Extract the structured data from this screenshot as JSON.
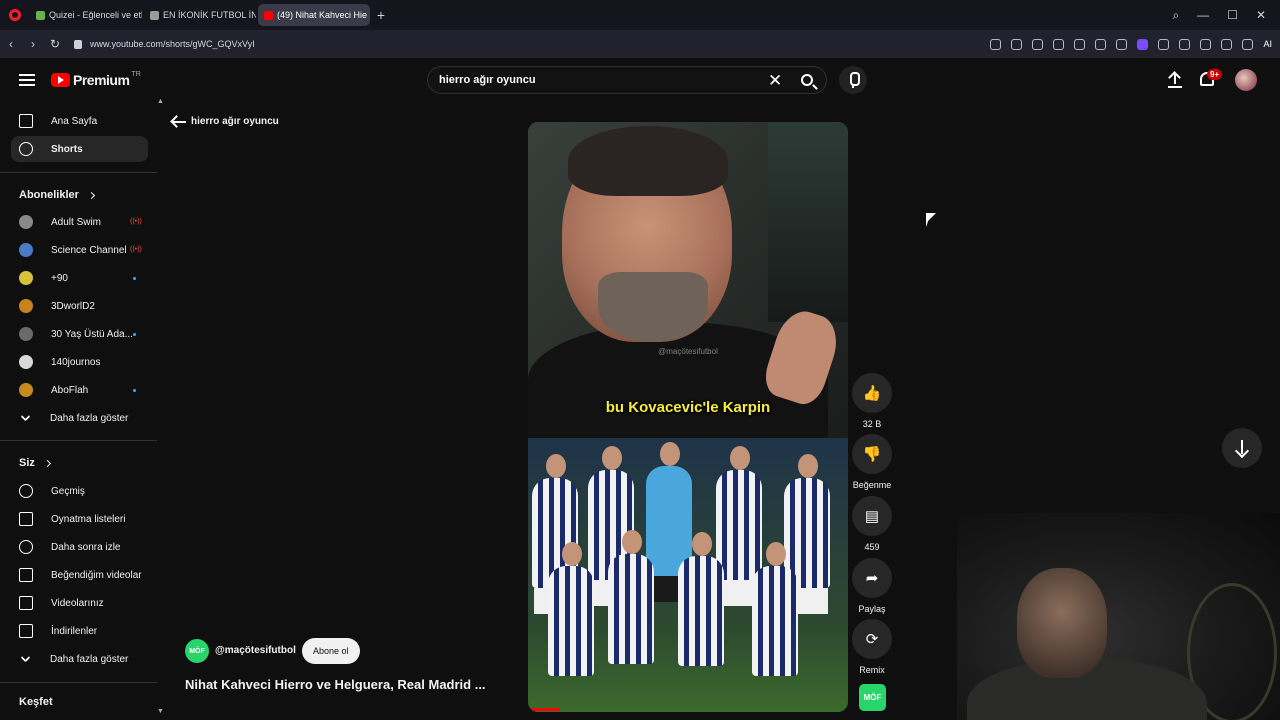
{
  "browser": {
    "tabs": [
      {
        "label": "Quizei - Eğlenceli ve etkile",
        "fav": "#6ab04c",
        "active": false
      },
      {
        "label": "EN İKONİK FUTBOL İNTİKA",
        "fav": "#9b9b9b",
        "active": false
      },
      {
        "label": "(49) Nihat Kahveci Hie",
        "fav": "#ff0000",
        "active": true
      }
    ],
    "new_tab": "+",
    "url": "www.youtube.com/shorts/gWC_GQVxVyI",
    "ai_label": "AI"
  },
  "header": {
    "logo_text": "Premium",
    "logo_sup": "TR",
    "search_value": "hierro ağır oyuncu",
    "notification_count": "9+"
  },
  "sidebar": {
    "main": [
      {
        "label": "Ana Sayfa",
        "icon": "home-icon"
      },
      {
        "label": "Shorts",
        "icon": "shorts-icon",
        "active": true
      }
    ],
    "subscriptions_title": "Abonelikler",
    "subscriptions": [
      {
        "label": "Adult Swim",
        "indicator": "live",
        "color": "#888888"
      },
      {
        "label": "Science Channel",
        "indicator": "live",
        "color": "#4a7bc4"
      },
      {
        "label": "+90",
        "indicator": "dot",
        "color": "#d4c23a"
      },
      {
        "label": "3DworlD2",
        "indicator": "",
        "color": "#c7821d"
      },
      {
        "label": "30 Yaş Üstü Ada...",
        "indicator": "dot",
        "color": "#6a6a6a"
      },
      {
        "label": "140journos",
        "indicator": "",
        "color": "#d9d9d9"
      },
      {
        "label": "AboFlah",
        "indicator": "dot",
        "color": "#c68b1c"
      }
    ],
    "show_more": "Daha fazla göster",
    "you_title": "Siz",
    "you_items": [
      {
        "label": "Geçmiş",
        "icon": "history-icon"
      },
      {
        "label": "Oynatma listeleri",
        "icon": "playlists-icon"
      },
      {
        "label": "Daha sonra izle",
        "icon": "watch-later-icon"
      },
      {
        "label": "Beğendiğim videolar",
        "icon": "liked-videos-icon"
      },
      {
        "label": "Videolarınız",
        "icon": "your-videos-icon"
      },
      {
        "label": "İndirilenler",
        "icon": "downloads-icon"
      }
    ],
    "show_more_2": "Daha fazla göster",
    "explore_title": "Keşfet"
  },
  "main": {
    "back_label": "hierro ağır oyuncu",
    "watermark": "@maçötesifutbol",
    "caption": "bu Kovacevic'le Karpin",
    "actions": {
      "likes": "32 B",
      "dislike": "Beğenme",
      "comments": "459",
      "share": "Paylaş",
      "remix": "Remix"
    },
    "channel_name": "@maçötesifutbol",
    "channel_initials": "MÖF",
    "subscribe": "Abone ol",
    "video_title": "Nihat Kahveci Hierro ve Helguera, Real Madrid ..."
  }
}
